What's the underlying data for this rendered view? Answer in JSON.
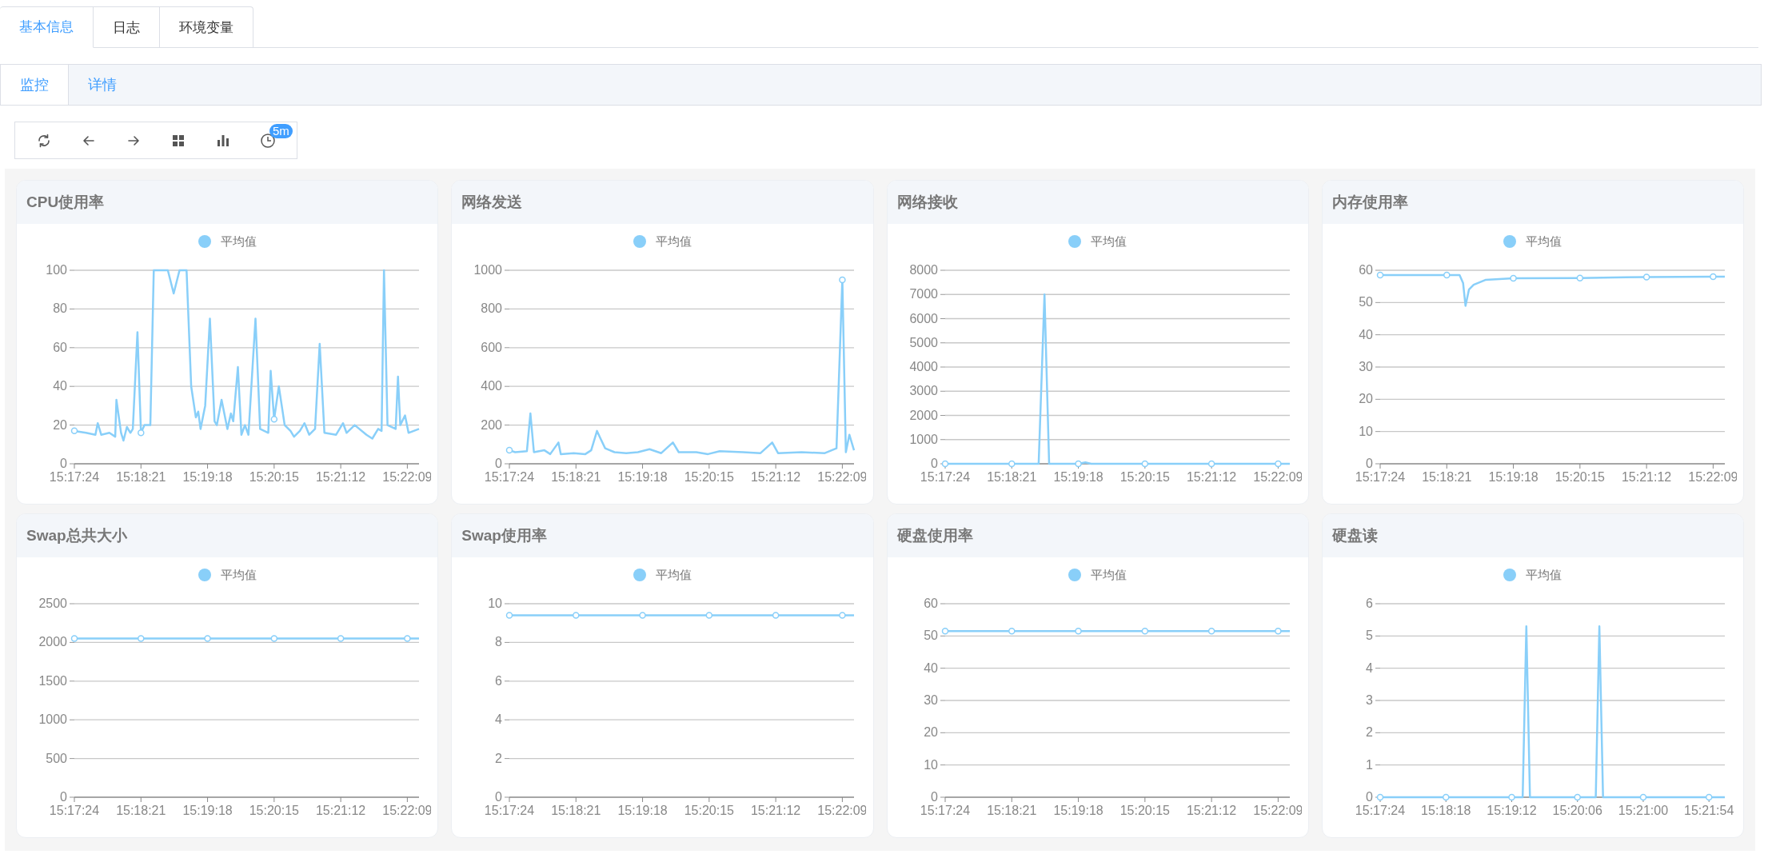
{
  "tabs": [
    {
      "label": "基本信息",
      "selected": true
    },
    {
      "label": "日志",
      "selected": false
    },
    {
      "label": "环境变量",
      "selected": false
    }
  ],
  "subtabs": [
    {
      "label": "监控",
      "selected": true
    },
    {
      "label": "详情",
      "selected": false
    }
  ],
  "toolbar": {
    "badge": "5m"
  },
  "cards": [
    {
      "title": "CPU使用率",
      "chart_data": {
        "type": "line",
        "x": [
          55044,
          55054,
          55062,
          55064,
          55067,
          55074,
          55079,
          55080,
          55084,
          55086,
          55089,
          55092,
          55094,
          55098,
          55101,
          55104,
          55109,
          55112,
          55124,
          55129,
          55134,
          55140,
          55144,
          55148,
          55150,
          55152,
          55156,
          55160,
          55164,
          55166,
          55170,
          55175,
          55178,
          55180,
          55184,
          55187,
          55190,
          55193,
          55199,
          55203,
          55210,
          55212,
          55215,
          55219,
          55224,
          55229,
          55232,
          55237,
          55241,
          55245,
          55250,
          55254,
          55258,
          55268,
          55274,
          55277,
          55284,
          55294,
          55299,
          55304,
          55307,
          55309,
          55312,
          55319,
          55321,
          55323,
          55327,
          55330,
          55339
        ],
        "grid": true,
        "xlim": [
          55044,
          55339
        ],
        "ylim": [
          0,
          100
        ],
        "yticks": [
          0,
          20,
          40,
          60,
          80,
          100
        ],
        "xticks": [
          {
            "value": 55044,
            "label": "15:17:24"
          },
          {
            "value": 55101,
            "label": "15:18:21"
          },
          {
            "value": 55158,
            "label": "15:19:18"
          },
          {
            "value": 55215,
            "label": "15:20:15"
          },
          {
            "value": 55272,
            "label": "15:21:12"
          },
          {
            "value": 55329,
            "label": "15:22:09"
          }
        ],
        "series": [
          {
            "name": "平均值",
            "color": "#89cff9",
            "marker": true,
            "values": [
              17,
              16,
              15,
              21,
              15,
              16,
              14,
              33,
              16,
              12,
              19,
              16,
              18,
              68,
              16,
              20,
              20,
              100,
              100,
              88,
              100,
              100,
              40,
              24,
              27,
              18,
              30,
              75,
              22,
              20,
              33,
              18,
              26,
              22,
              50,
              15,
              20,
              15,
              75,
              18,
              16,
              48,
              23,
              40,
              20,
              17,
              14,
              17,
              21,
              15,
              18,
              62,
              16,
              15,
              21,
              16,
              20,
              15,
              13,
              18,
              17,
              100,
              20,
              18,
              45,
              20,
              25,
              16,
              18
            ]
          }
        ]
      }
    },
    {
      "title": "网络发送",
      "chart_data": {
        "type": "line",
        "x": [
          55044,
          55049,
          55059,
          55062,
          55065,
          55074,
          55079,
          55086,
          55088,
          55099,
          55109,
          55114,
          55119,
          55122,
          55126,
          55134,
          55144,
          55154,
          55164,
          55174,
          55184,
          55189,
          55204,
          55214,
          55224,
          55244,
          55259,
          55269,
          55274,
          55294,
          55314,
          55324,
          55329,
          55332,
          55335,
          55339
        ],
        "grid": true,
        "xlim": [
          55044,
          55339
        ],
        "ylim": [
          0,
          1000
        ],
        "yticks": [
          0,
          200,
          400,
          600,
          800,
          1000
        ],
        "xticks": [
          {
            "value": 55044,
            "label": "15:17:24"
          },
          {
            "value": 55101,
            "label": "15:18:21"
          },
          {
            "value": 55158,
            "label": "15:19:18"
          },
          {
            "value": 55215,
            "label": "15:20:15"
          },
          {
            "value": 55272,
            "label": "15:21:12"
          },
          {
            "value": 55329,
            "label": "15:22:09"
          }
        ],
        "series": [
          {
            "name": "平均值",
            "color": "#89cff9",
            "marker": true,
            "values": [
              70,
              60,
              65,
              260,
              60,
              70,
              50,
              110,
              50,
              55,
              50,
              70,
              170,
              130,
              80,
              60,
              55,
              60,
              75,
              55,
              110,
              60,
              60,
              50,
              65,
              60,
              55,
              110,
              55,
              60,
              55,
              80,
              950,
              60,
              150,
              70
            ]
          }
        ]
      }
    },
    {
      "title": "网络接收",
      "chart_data": {
        "type": "line",
        "x": [
          55044,
          55101,
          55124,
          55129,
          55133,
          55158,
          55164,
          55169,
          55215,
          55272,
          55329,
          55339
        ],
        "grid": true,
        "xlim": [
          55044,
          55339
        ],
        "ylim": [
          0,
          8000
        ],
        "yticks": [
          0,
          1000,
          2000,
          3000,
          4000,
          5000,
          6000,
          7000,
          8000
        ],
        "xticks": [
          {
            "value": 55044,
            "label": "15:17:24"
          },
          {
            "value": 55101,
            "label": "15:18:21"
          },
          {
            "value": 55158,
            "label": "15:19:18"
          },
          {
            "value": 55215,
            "label": "15:20:15"
          },
          {
            "value": 55272,
            "label": "15:21:12"
          },
          {
            "value": 55329,
            "label": "15:22:09"
          }
        ],
        "series": [
          {
            "name": "平均值",
            "color": "#89cff9",
            "marker": true,
            "values": [
              0,
              0,
              0,
              7000,
              0,
              0,
              60,
              0,
              0,
              0,
              0,
              0
            ]
          }
        ]
      }
    },
    {
      "title": "内存使用率",
      "chart_data": {
        "type": "line",
        "x": [
          55044,
          55101,
          55112,
          55115,
          55117,
          55120,
          55124,
          55134,
          55158,
          55215,
          55244,
          55272,
          55329,
          55339
        ],
        "grid": true,
        "xlim": [
          55044,
          55339
        ],
        "ylim": [
          0,
          60
        ],
        "yticks": [
          0,
          10,
          20,
          30,
          40,
          50,
          60
        ],
        "xticks": [
          {
            "value": 55044,
            "label": "15:17:24"
          },
          {
            "value": 55101,
            "label": "15:18:21"
          },
          {
            "value": 55158,
            "label": "15:19:18"
          },
          {
            "value": 55215,
            "label": "15:20:15"
          },
          {
            "value": 55272,
            "label": "15:21:12"
          },
          {
            "value": 55329,
            "label": "15:22:09"
          }
        ],
        "series": [
          {
            "name": "平均值",
            "color": "#89cff9",
            "marker": true,
            "values": [
              58.5,
              58.5,
              58.5,
              56,
              49,
              54,
              55.5,
              57,
              57.5,
              57.6,
              57.8,
              57.9,
              58,
              58
            ]
          }
        ]
      }
    },
    {
      "title": "Swap总共大小",
      "chart_data": {
        "type": "line",
        "x": [
          55044,
          55101,
          55158,
          55215,
          55272,
          55329,
          55339
        ],
        "grid": true,
        "xlim": [
          55044,
          55339
        ],
        "ylim": [
          0,
          2500
        ],
        "yticks": [
          0,
          500,
          1000,
          1500,
          2000,
          2500
        ],
        "xticks": [
          {
            "value": 55044,
            "label": "15:17:24"
          },
          {
            "value": 55101,
            "label": "15:18:21"
          },
          {
            "value": 55158,
            "label": "15:19:18"
          },
          {
            "value": 55215,
            "label": "15:20:15"
          },
          {
            "value": 55272,
            "label": "15:21:12"
          },
          {
            "value": 55329,
            "label": "15:22:09"
          }
        ],
        "series": [
          {
            "name": "平均值",
            "color": "#89cff9",
            "marker": true,
            "values": [
              2050,
              2050,
              2050,
              2050,
              2050,
              2050,
              2050
            ]
          }
        ]
      }
    },
    {
      "title": "Swap使用率",
      "chart_data": {
        "type": "line",
        "x": [
          55044,
          55101,
          55158,
          55215,
          55272,
          55329,
          55339
        ],
        "grid": true,
        "xlim": [
          55044,
          55339
        ],
        "ylim": [
          0,
          10
        ],
        "yticks": [
          0,
          2,
          4,
          6,
          8,
          10
        ],
        "xticks": [
          {
            "value": 55044,
            "label": "15:17:24"
          },
          {
            "value": 55101,
            "label": "15:18:21"
          },
          {
            "value": 55158,
            "label": "15:19:18"
          },
          {
            "value": 55215,
            "label": "15:20:15"
          },
          {
            "value": 55272,
            "label": "15:21:12"
          },
          {
            "value": 55329,
            "label": "15:22:09"
          }
        ],
        "series": [
          {
            "name": "平均值",
            "color": "#89cff9",
            "marker": true,
            "values": [
              9.4,
              9.4,
              9.4,
              9.4,
              9.4,
              9.4,
              9.4
            ]
          }
        ]
      }
    },
    {
      "title": "硬盘使用率",
      "chart_data": {
        "type": "line",
        "x": [
          55044,
          55101,
          55158,
          55215,
          55272,
          55329,
          55339
        ],
        "grid": true,
        "xlim": [
          55044,
          55339
        ],
        "ylim": [
          0,
          60
        ],
        "yticks": [
          0,
          10,
          20,
          30,
          40,
          50,
          60
        ],
        "xticks": [
          {
            "value": 55044,
            "label": "15:17:24"
          },
          {
            "value": 55101,
            "label": "15:18:21"
          },
          {
            "value": 55158,
            "label": "15:19:18"
          },
          {
            "value": 55215,
            "label": "15:20:15"
          },
          {
            "value": 55272,
            "label": "15:21:12"
          },
          {
            "value": 55329,
            "label": "15:22:09"
          }
        ],
        "series": [
          {
            "name": "平均值",
            "color": "#89cff9",
            "marker": true,
            "values": [
              51.5,
              51.5,
              51.5,
              51.5,
              51.5,
              51.5,
              51.5
            ]
          }
        ]
      }
    },
    {
      "title": "硬盘读",
      "chart_data": {
        "type": "line",
        "x": [
          55044,
          55098,
          55152,
          55161,
          55164,
          55167,
          55206,
          55221,
          55224,
          55227,
          55260,
          55314,
          55327
        ],
        "grid": true,
        "xlim": [
          55044,
          55327
        ],
        "ylim": [
          0,
          6
        ],
        "yticks": [
          0,
          1,
          2,
          3,
          4,
          5,
          6
        ],
        "xticks": [
          {
            "value": 55044,
            "label": "15:17:24"
          },
          {
            "value": 55098,
            "label": "15:18:18"
          },
          {
            "value": 55152,
            "label": "15:19:12"
          },
          {
            "value": 55206,
            "label": "15:20:06"
          },
          {
            "value": 55260,
            "label": "15:21:00"
          },
          {
            "value": 55314,
            "label": "15:21:54"
          }
        ],
        "series": [
          {
            "name": "平均值",
            "color": "#89cff9",
            "marker": true,
            "values": [
              0,
              0,
              0,
              0,
              5.3,
              0,
              0,
              0,
              5.3,
              0,
              0,
              0,
              0
            ]
          }
        ]
      }
    }
  ]
}
